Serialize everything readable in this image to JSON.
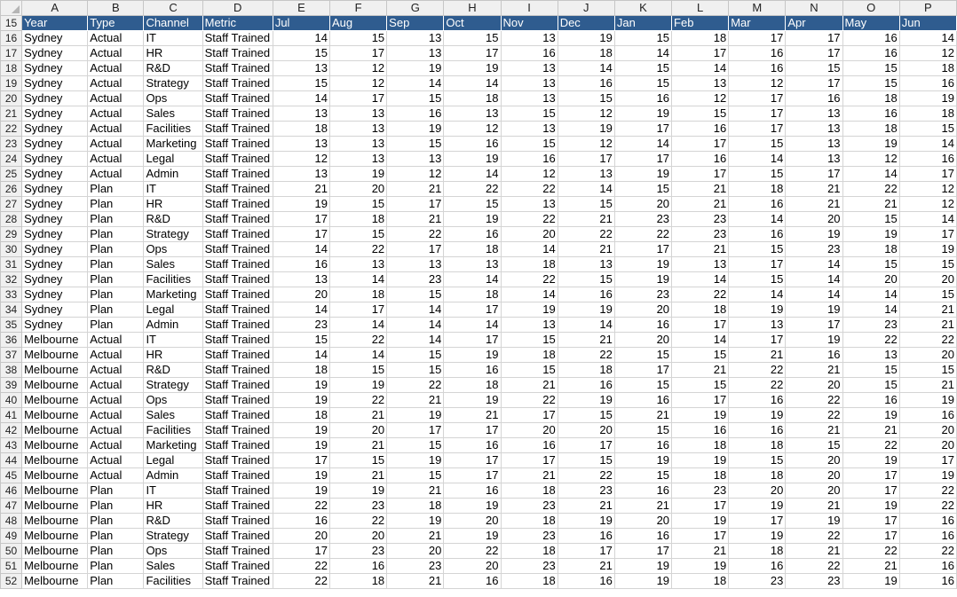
{
  "columns": [
    "A",
    "B",
    "C",
    "D",
    "E",
    "F",
    "G",
    "H",
    "I",
    "J",
    "K",
    "L",
    "M",
    "N",
    "O",
    "P"
  ],
  "header_row_number": "15",
  "header": [
    "Year",
    "Type",
    "Channel",
    "Metric",
    "Jul",
    "Aug",
    "Sep",
    "Oct",
    "Nov",
    "Dec",
    "Jan",
    "Feb",
    "Mar",
    "Apr",
    "May",
    "Jun"
  ],
  "rows": [
    {
      "n": "16",
      "c": [
        "Sydney",
        "Actual",
        "IT",
        "Staff Trained",
        "14",
        "15",
        "13",
        "15",
        "13",
        "19",
        "15",
        "18",
        "17",
        "17",
        "16",
        "14"
      ]
    },
    {
      "n": "17",
      "c": [
        "Sydney",
        "Actual",
        "HR",
        "Staff Trained",
        "15",
        "17",
        "13",
        "17",
        "16",
        "18",
        "14",
        "17",
        "16",
        "17",
        "16",
        "12"
      ]
    },
    {
      "n": "18",
      "c": [
        "Sydney",
        "Actual",
        "R&D",
        "Staff Trained",
        "13",
        "12",
        "19",
        "19",
        "13",
        "14",
        "15",
        "14",
        "16",
        "15",
        "15",
        "18"
      ]
    },
    {
      "n": "19",
      "c": [
        "Sydney",
        "Actual",
        "Strategy",
        "Staff Trained",
        "15",
        "12",
        "14",
        "14",
        "13",
        "16",
        "15",
        "13",
        "12",
        "17",
        "15",
        "16"
      ]
    },
    {
      "n": "20",
      "c": [
        "Sydney",
        "Actual",
        "Ops",
        "Staff Trained",
        "14",
        "17",
        "15",
        "18",
        "13",
        "15",
        "16",
        "12",
        "17",
        "16",
        "18",
        "19"
      ]
    },
    {
      "n": "21",
      "c": [
        "Sydney",
        "Actual",
        "Sales",
        "Staff Trained",
        "13",
        "13",
        "16",
        "13",
        "15",
        "12",
        "19",
        "15",
        "17",
        "13",
        "16",
        "18"
      ]
    },
    {
      "n": "22",
      "c": [
        "Sydney",
        "Actual",
        "Facilities",
        "Staff Trained",
        "18",
        "13",
        "19",
        "12",
        "13",
        "19",
        "17",
        "16",
        "17",
        "13",
        "18",
        "15"
      ]
    },
    {
      "n": "23",
      "c": [
        "Sydney",
        "Actual",
        "Marketing",
        "Staff Trained",
        "13",
        "13",
        "15",
        "16",
        "15",
        "12",
        "14",
        "17",
        "15",
        "13",
        "19",
        "14"
      ]
    },
    {
      "n": "24",
      "c": [
        "Sydney",
        "Actual",
        "Legal",
        "Staff Trained",
        "12",
        "13",
        "13",
        "19",
        "16",
        "17",
        "17",
        "16",
        "14",
        "13",
        "12",
        "16"
      ]
    },
    {
      "n": "25",
      "c": [
        "Sydney",
        "Actual",
        "Admin",
        "Staff Trained",
        "13",
        "19",
        "12",
        "14",
        "12",
        "13",
        "19",
        "17",
        "15",
        "17",
        "14",
        "17"
      ]
    },
    {
      "n": "26",
      "c": [
        "Sydney",
        "Plan",
        "IT",
        "Staff Trained",
        "21",
        "20",
        "21",
        "22",
        "22",
        "14",
        "15",
        "21",
        "18",
        "21",
        "22",
        "12"
      ]
    },
    {
      "n": "27",
      "c": [
        "Sydney",
        "Plan",
        "HR",
        "Staff Trained",
        "19",
        "15",
        "17",
        "15",
        "13",
        "15",
        "20",
        "21",
        "16",
        "21",
        "21",
        "12"
      ]
    },
    {
      "n": "28",
      "c": [
        "Sydney",
        "Plan",
        "R&D",
        "Staff Trained",
        "17",
        "18",
        "21",
        "19",
        "22",
        "21",
        "23",
        "23",
        "14",
        "20",
        "15",
        "14"
      ]
    },
    {
      "n": "29",
      "c": [
        "Sydney",
        "Plan",
        "Strategy",
        "Staff Trained",
        "17",
        "15",
        "22",
        "16",
        "20",
        "22",
        "22",
        "23",
        "16",
        "19",
        "19",
        "17"
      ]
    },
    {
      "n": "30",
      "c": [
        "Sydney",
        "Plan",
        "Ops",
        "Staff Trained",
        "14",
        "22",
        "17",
        "18",
        "14",
        "21",
        "17",
        "21",
        "15",
        "23",
        "18",
        "19"
      ]
    },
    {
      "n": "31",
      "c": [
        "Sydney",
        "Plan",
        "Sales",
        "Staff Trained",
        "16",
        "13",
        "13",
        "13",
        "18",
        "13",
        "19",
        "13",
        "17",
        "14",
        "15",
        "15"
      ]
    },
    {
      "n": "32",
      "c": [
        "Sydney",
        "Plan",
        "Facilities",
        "Staff Trained",
        "13",
        "14",
        "23",
        "14",
        "22",
        "15",
        "19",
        "14",
        "15",
        "14",
        "20",
        "20"
      ]
    },
    {
      "n": "33",
      "c": [
        "Sydney",
        "Plan",
        "Marketing",
        "Staff Trained",
        "20",
        "18",
        "15",
        "18",
        "14",
        "16",
        "23",
        "22",
        "14",
        "14",
        "14",
        "15"
      ]
    },
    {
      "n": "34",
      "c": [
        "Sydney",
        "Plan",
        "Legal",
        "Staff Trained",
        "14",
        "17",
        "14",
        "17",
        "19",
        "19",
        "20",
        "18",
        "19",
        "19",
        "14",
        "21"
      ]
    },
    {
      "n": "35",
      "c": [
        "Sydney",
        "Plan",
        "Admin",
        "Staff Trained",
        "23",
        "14",
        "14",
        "14",
        "13",
        "14",
        "16",
        "17",
        "13",
        "17",
        "23",
        "21"
      ]
    },
    {
      "n": "36",
      "c": [
        "Melbourne",
        "Actual",
        "IT",
        "Staff Trained",
        "15",
        "22",
        "14",
        "17",
        "15",
        "21",
        "20",
        "14",
        "17",
        "19",
        "22",
        "22"
      ]
    },
    {
      "n": "37",
      "c": [
        "Melbourne",
        "Actual",
        "HR",
        "Staff Trained",
        "14",
        "14",
        "15",
        "19",
        "18",
        "22",
        "15",
        "15",
        "21",
        "16",
        "13",
        "20"
      ]
    },
    {
      "n": "38",
      "c": [
        "Melbourne",
        "Actual",
        "R&D",
        "Staff Trained",
        "18",
        "15",
        "15",
        "16",
        "15",
        "18",
        "17",
        "21",
        "22",
        "21",
        "15",
        "15"
      ]
    },
    {
      "n": "39",
      "c": [
        "Melbourne",
        "Actual",
        "Strategy",
        "Staff Trained",
        "19",
        "19",
        "22",
        "18",
        "21",
        "16",
        "15",
        "15",
        "22",
        "20",
        "15",
        "21"
      ]
    },
    {
      "n": "40",
      "c": [
        "Melbourne",
        "Actual",
        "Ops",
        "Staff Trained",
        "19",
        "22",
        "21",
        "19",
        "22",
        "19",
        "16",
        "17",
        "16",
        "22",
        "16",
        "19"
      ]
    },
    {
      "n": "41",
      "c": [
        "Melbourne",
        "Actual",
        "Sales",
        "Staff Trained",
        "18",
        "21",
        "19",
        "21",
        "17",
        "15",
        "21",
        "19",
        "19",
        "22",
        "19",
        "16"
      ]
    },
    {
      "n": "42",
      "c": [
        "Melbourne",
        "Actual",
        "Facilities",
        "Staff Trained",
        "19",
        "20",
        "17",
        "17",
        "20",
        "20",
        "15",
        "16",
        "16",
        "21",
        "21",
        "20"
      ]
    },
    {
      "n": "43",
      "c": [
        "Melbourne",
        "Actual",
        "Marketing",
        "Staff Trained",
        "19",
        "21",
        "15",
        "16",
        "16",
        "17",
        "16",
        "18",
        "18",
        "15",
        "22",
        "20"
      ]
    },
    {
      "n": "44",
      "c": [
        "Melbourne",
        "Actual",
        "Legal",
        "Staff Trained",
        "17",
        "15",
        "19",
        "17",
        "17",
        "15",
        "19",
        "19",
        "15",
        "20",
        "19",
        "17"
      ]
    },
    {
      "n": "45",
      "c": [
        "Melbourne",
        "Actual",
        "Admin",
        "Staff Trained",
        "19",
        "21",
        "15",
        "17",
        "21",
        "22",
        "15",
        "18",
        "18",
        "20",
        "17",
        "19"
      ]
    },
    {
      "n": "46",
      "c": [
        "Melbourne",
        "Plan",
        "IT",
        "Staff Trained",
        "19",
        "19",
        "21",
        "16",
        "18",
        "23",
        "16",
        "23",
        "20",
        "20",
        "17",
        "22"
      ]
    },
    {
      "n": "47",
      "c": [
        "Melbourne",
        "Plan",
        "HR",
        "Staff Trained",
        "22",
        "23",
        "18",
        "19",
        "23",
        "21",
        "21",
        "17",
        "19",
        "21",
        "19",
        "22"
      ]
    },
    {
      "n": "48",
      "c": [
        "Melbourne",
        "Plan",
        "R&D",
        "Staff Trained",
        "16",
        "22",
        "19",
        "20",
        "18",
        "19",
        "20",
        "19",
        "17",
        "19",
        "17",
        "16"
      ]
    },
    {
      "n": "49",
      "c": [
        "Melbourne",
        "Plan",
        "Strategy",
        "Staff Trained",
        "20",
        "20",
        "21",
        "19",
        "23",
        "16",
        "16",
        "17",
        "19",
        "22",
        "17",
        "16"
      ]
    },
    {
      "n": "50",
      "c": [
        "Melbourne",
        "Plan",
        "Ops",
        "Staff Trained",
        "17",
        "23",
        "20",
        "22",
        "18",
        "17",
        "17",
        "21",
        "18",
        "21",
        "22",
        "22"
      ]
    },
    {
      "n": "51",
      "c": [
        "Melbourne",
        "Plan",
        "Sales",
        "Staff Trained",
        "22",
        "16",
        "23",
        "20",
        "23",
        "21",
        "19",
        "19",
        "16",
        "22",
        "21",
        "16"
      ]
    },
    {
      "n": "52",
      "c": [
        "Melbourne",
        "Plan",
        "Facilities",
        "Staff Trained",
        "22",
        "18",
        "21",
        "16",
        "18",
        "16",
        "19",
        "18",
        "23",
        "23",
        "19",
        "16"
      ]
    }
  ],
  "colors": {
    "header_fill": "#2f5c8f",
    "header_text": "#ffffff",
    "gridline": "#d4d4d4",
    "headings_fill": "#f0f0f0"
  }
}
